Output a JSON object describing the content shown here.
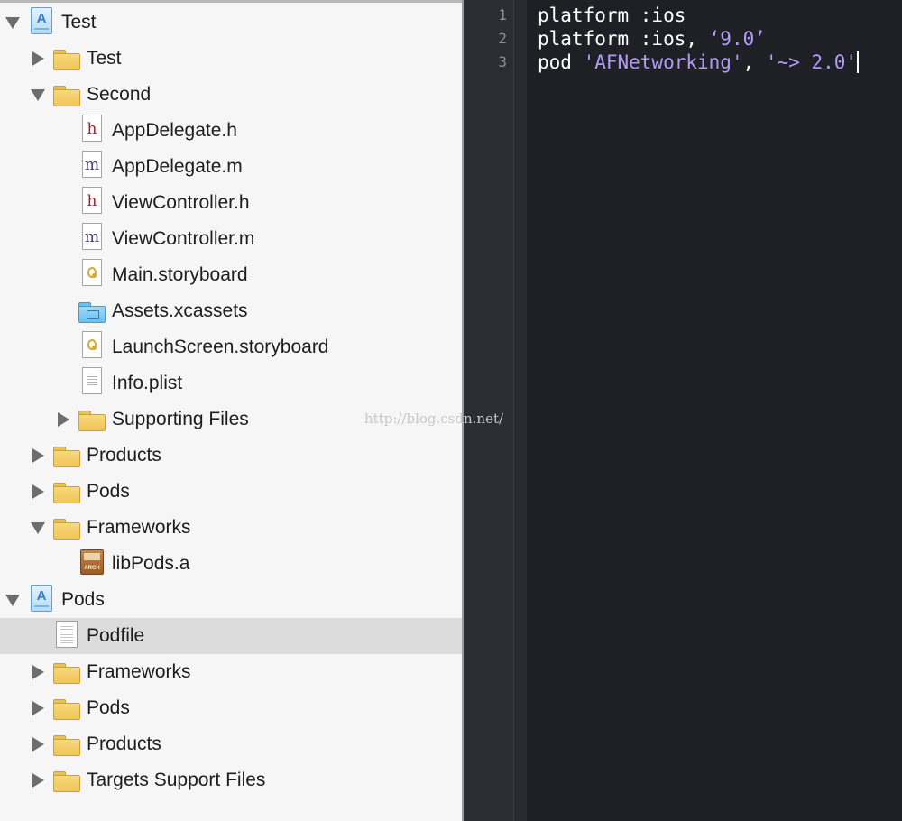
{
  "navigator": {
    "items": [
      {
        "label": "Test",
        "icon": "xcode-project-icon",
        "disclosure": "expanded",
        "selected": false
      },
      {
        "label": "Test",
        "icon": "folder-icon",
        "disclosure": "collapsed",
        "selected": false
      },
      {
        "label": "Second",
        "icon": "folder-icon",
        "disclosure": "expanded",
        "selected": false
      },
      {
        "label": "AppDelegate.h",
        "icon": "header-file-icon",
        "disclosure": "none",
        "selected": false
      },
      {
        "label": "AppDelegate.m",
        "icon": "source-file-icon",
        "disclosure": "none",
        "selected": false
      },
      {
        "label": "ViewController.h",
        "icon": "header-file-icon",
        "disclosure": "none",
        "selected": false
      },
      {
        "label": "ViewController.m",
        "icon": "source-file-icon",
        "disclosure": "none",
        "selected": false
      },
      {
        "label": "Main.storyboard",
        "icon": "storyboard-file-icon",
        "disclosure": "none",
        "selected": false
      },
      {
        "label": "Assets.xcassets",
        "icon": "asset-catalog-icon",
        "disclosure": "none",
        "selected": false
      },
      {
        "label": "LaunchScreen.storyboard",
        "icon": "storyboard-file-icon",
        "disclosure": "none",
        "selected": false
      },
      {
        "label": "Info.plist",
        "icon": "plist-file-icon",
        "disclosure": "none",
        "selected": false
      },
      {
        "label": "Supporting Files",
        "icon": "folder-icon",
        "disclosure": "collapsed",
        "selected": false
      },
      {
        "label": "Products",
        "icon": "folder-icon",
        "disclosure": "collapsed",
        "selected": false
      },
      {
        "label": "Pods",
        "icon": "folder-icon",
        "disclosure": "collapsed",
        "selected": false
      },
      {
        "label": "Frameworks",
        "icon": "folder-icon",
        "disclosure": "expanded",
        "selected": false
      },
      {
        "label": "libPods.a",
        "icon": "static-library-icon",
        "disclosure": "none",
        "selected": false
      },
      {
        "label": "Pods",
        "icon": "xcode-project-icon",
        "disclosure": "expanded",
        "selected": false
      },
      {
        "label": "Podfile",
        "icon": "text-file-icon",
        "disclosure": "none",
        "selected": true
      },
      {
        "label": "Frameworks",
        "icon": "folder-icon",
        "disclosure": "collapsed",
        "selected": false
      },
      {
        "label": "Pods",
        "icon": "folder-icon",
        "disclosure": "collapsed",
        "selected": false
      },
      {
        "label": "Products",
        "icon": "folder-icon",
        "disclosure": "collapsed",
        "selected": false
      },
      {
        "label": "Targets Support Files",
        "icon": "folder-icon",
        "disclosure": "collapsed",
        "selected": false
      }
    ]
  },
  "editor": {
    "line_numbers": [
      "1",
      "2",
      "3"
    ],
    "lines": {
      "l1": {
        "text": "platform :ios"
      },
      "l2": {
        "pre": "platform :ios, ",
        "str": "‘9.0’"
      },
      "l3": {
        "pre": "pod ",
        "str1": "'AFNetworking'",
        "mid": ", ",
        "str2": "'~> 2.0'"
      }
    }
  },
  "watermark": "http://blog.csdn.net/",
  "colors": {
    "editor_background": "#1f2026",
    "string_literal": "#b39af5",
    "selection_row": "#dcdcdc",
    "folder_yellow": "#eec558"
  }
}
